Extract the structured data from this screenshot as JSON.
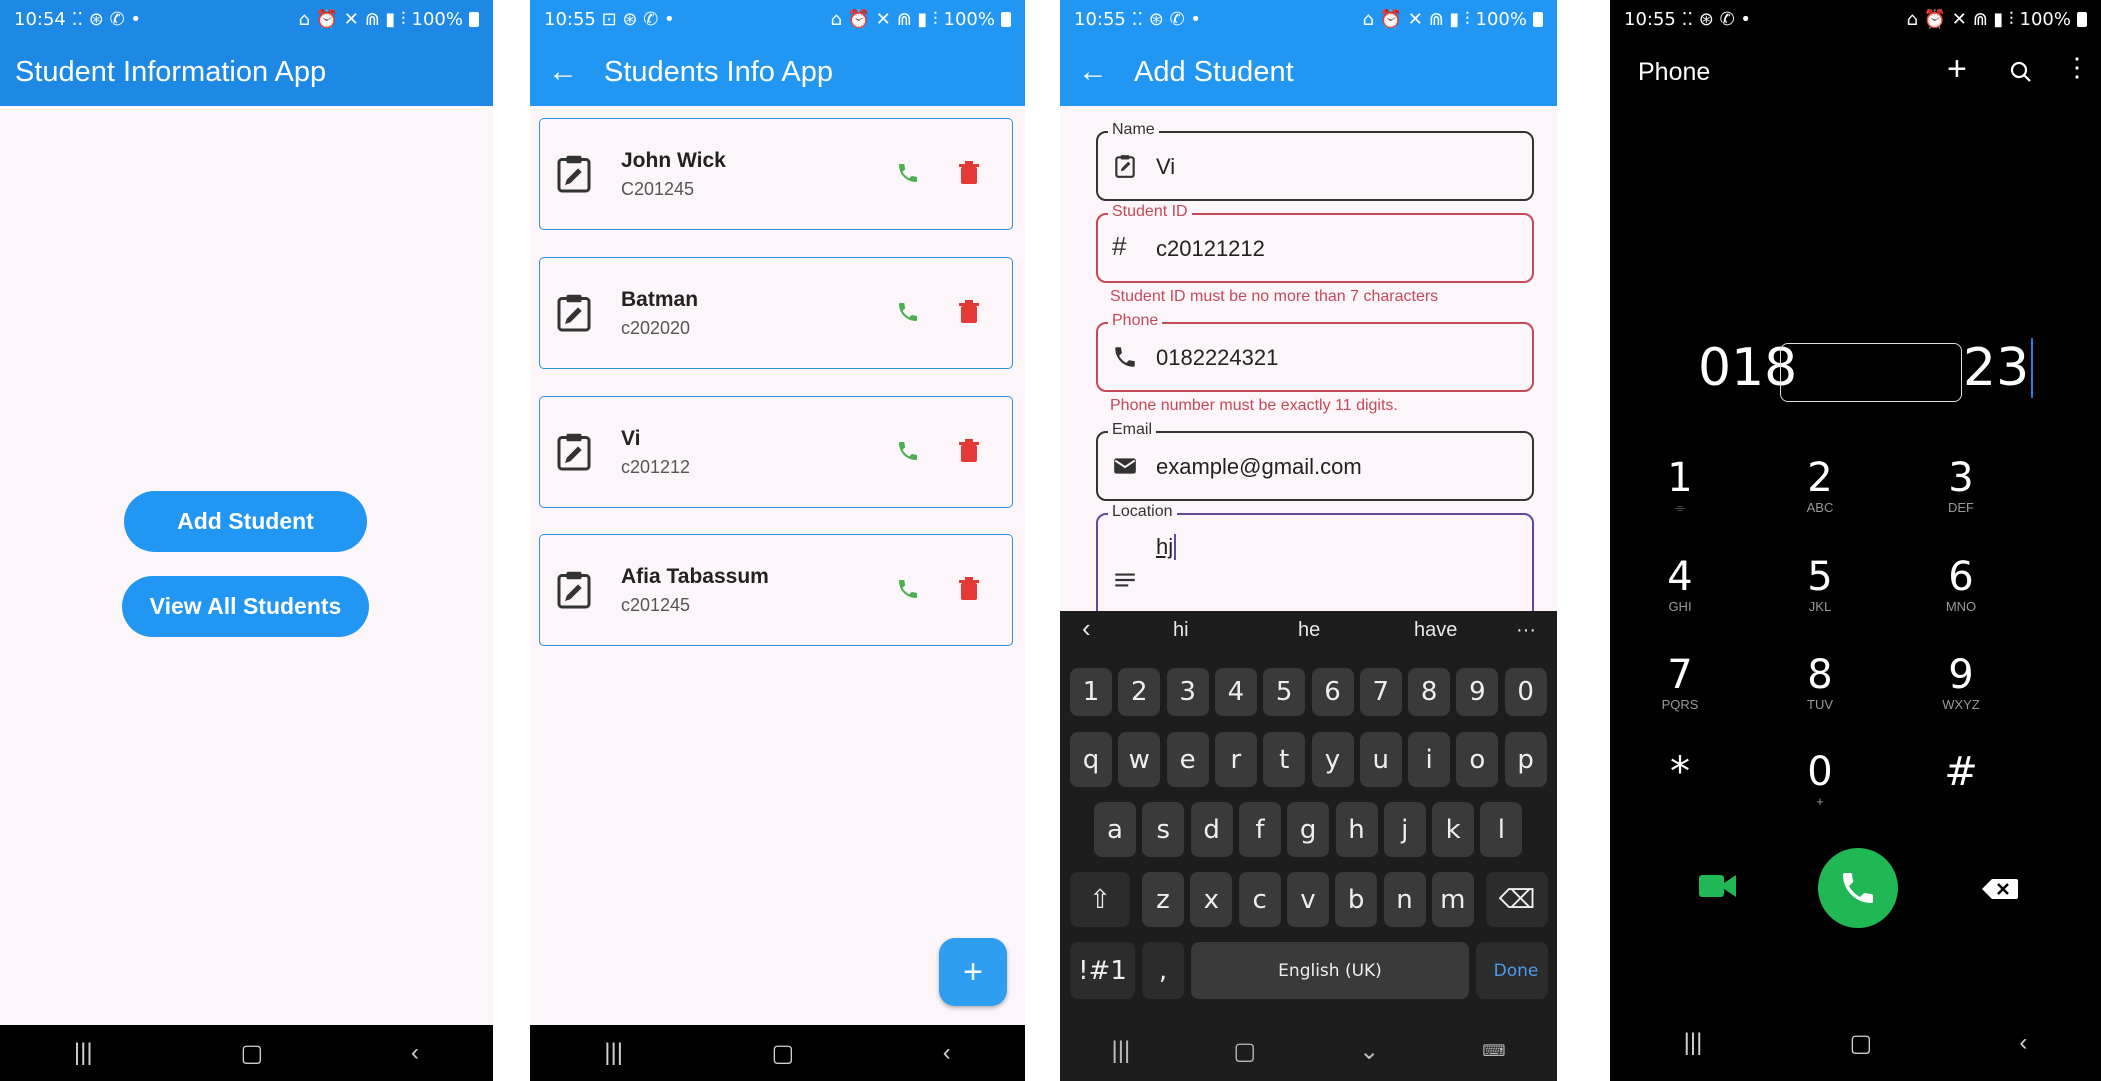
{
  "status_bars": [
    {
      "time": "10:54",
      "left_icons": "⁚⁚ ⊛ ✆ •",
      "right_icons": "⌂ ⏰ ✕ ⋒ ▮ ⫶",
      "battery": "100%"
    },
    {
      "time": "10:55",
      "left_icons": "⊡ ⊛ ✆ •",
      "right_icons": "⌂ ⏰ ✕ ⋒ ▮ ⫶",
      "battery": "100%"
    },
    {
      "time": "10:55",
      "left_icons": "⁚⁚ ⊛ ✆ •",
      "right_icons": "⌂ ⏰ ✕ ⋒ ▮ ⫶",
      "battery": "100%"
    },
    {
      "time": "10:55",
      "left_icons": "⁚⁚ ⊛ ✆ •",
      "right_icons": "⌂ ⏰ ✕ ⋒ ▮ ⫶",
      "battery": "100%"
    }
  ],
  "screen1": {
    "title": "Student Information App",
    "add_button": "Add Student",
    "view_button": "View All Students"
  },
  "screen2": {
    "title": "Students Info App",
    "students": [
      {
        "name": "John Wick",
        "id": "C201245"
      },
      {
        "name": "Batman",
        "id": "c202020"
      },
      {
        "name": "Vi",
        "id": "c201212"
      },
      {
        "name": "Afia Tabassum",
        "id": "c201245"
      }
    ],
    "fab": "+"
  },
  "screen3": {
    "title": "Add Student",
    "fields": [
      {
        "label": "Name",
        "value": "Vi",
        "icon": "clipboard-edit-icon",
        "error": ""
      },
      {
        "label": "Student ID",
        "value": "c20121212",
        "icon": "hash-icon",
        "error": "Student ID must be no more than 7 characters"
      },
      {
        "label": "Phone",
        "value": "0182224321",
        "icon": "phone-icon",
        "error": "Phone number must be exactly 11 digits."
      },
      {
        "label": "Email",
        "value": "example@gmail.com",
        "icon": "mail-icon",
        "error": ""
      },
      {
        "label": "Location",
        "value": "hj",
        "icon": "notes-icon",
        "error": ""
      }
    ],
    "keyboard": {
      "suggestions": [
        "hi",
        "he",
        "have"
      ],
      "numbers": [
        "1",
        "2",
        "3",
        "4",
        "5",
        "6",
        "7",
        "8",
        "9",
        "0"
      ],
      "row1": [
        "q",
        "w",
        "e",
        "r",
        "t",
        "y",
        "u",
        "i",
        "o",
        "p"
      ],
      "row2": [
        "a",
        "s",
        "d",
        "f",
        "g",
        "h",
        "j",
        "k",
        "l"
      ],
      "row3": [
        "z",
        "x",
        "c",
        "v",
        "b",
        "n",
        "m"
      ],
      "symbols_key": "!#1",
      "comma_key": ",",
      "space_key": "English (UK)",
      "period_key": ".",
      "done_key": "Done"
    }
  },
  "screen4": {
    "title": "Phone",
    "number_left": "018",
    "number_right": "23",
    "dialpad": [
      {
        "digit": "1",
        "letters": "⌯"
      },
      {
        "digit": "2",
        "letters": "ABC"
      },
      {
        "digit": "3",
        "letters": "DEF"
      },
      {
        "digit": "4",
        "letters": "GHI"
      },
      {
        "digit": "5",
        "letters": "JKL"
      },
      {
        "digit": "6",
        "letters": "MNO"
      },
      {
        "digit": "7",
        "letters": "PQRS"
      },
      {
        "digit": "8",
        "letters": "TUV"
      },
      {
        "digit": "9",
        "letters": "WXYZ"
      },
      {
        "digit": "*",
        "letters": ""
      },
      {
        "digit": "0",
        "letters": "+"
      },
      {
        "digit": "#",
        "letters": ""
      }
    ]
  },
  "colors": {
    "primary": "#2196f3",
    "call_green": "#4caf50",
    "delete_red": "#e53935",
    "error_red": "#c44a57",
    "dialer_green": "#1fb855"
  }
}
